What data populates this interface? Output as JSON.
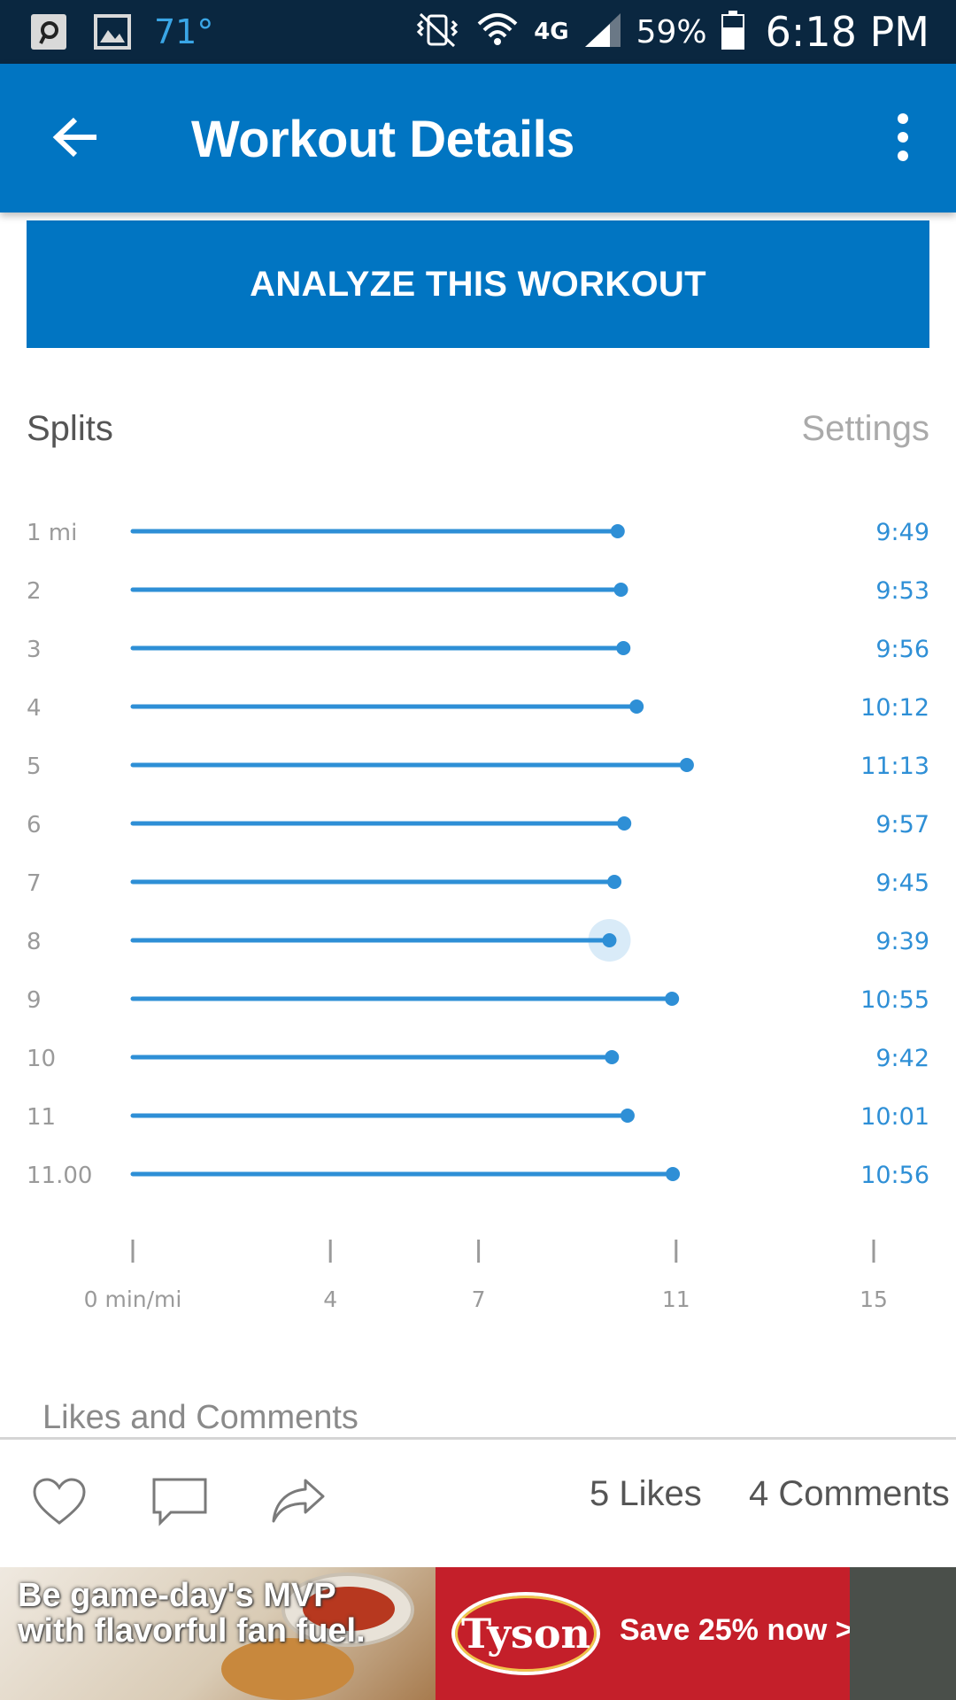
{
  "status_bar": {
    "temperature": "71°",
    "network": "4G",
    "battery": "59%",
    "time": "6:18 PM"
  },
  "app_bar": {
    "title": "Workout Details",
    "back_icon": "arrow-left-icon",
    "menu_icon": "more-vert-icon"
  },
  "analyze_button": "ANALYZE THIS WORKOUT",
  "splits": {
    "title": "Splits",
    "settings_label": "Settings"
  },
  "chart_data": {
    "type": "bar",
    "orientation": "horizontal",
    "categories": [
      "1 mi",
      "2",
      "3",
      "4",
      "5",
      "6",
      "7",
      "8",
      "9",
      "10",
      "11",
      "11.00"
    ],
    "values": [
      9.817,
      9.883,
      9.933,
      10.2,
      11.217,
      9.95,
      9.75,
      9.65,
      10.917,
      9.7,
      10.017,
      10.933
    ],
    "value_labels": [
      "9:49",
      "9:53",
      "9:56",
      "10:12",
      "11:13",
      "9:57",
      "9:45",
      "9:39",
      "10:55",
      "9:42",
      "10:01",
      "10:56"
    ],
    "highlighted_index": 7,
    "x_ticks": [
      0,
      4,
      7,
      11,
      15
    ],
    "x_tick_labels": [
      "0 min/mi",
      "4",
      "7",
      "11",
      "15"
    ],
    "xlim": [
      0,
      15
    ],
    "series_color": "#2e8fd6",
    "title": "",
    "xlabel": "",
    "ylabel": "",
    "grid": false
  },
  "social": {
    "heading": "Likes and Comments",
    "likes": "5 Likes",
    "comments": "4 Comments",
    "icons": [
      "heart-icon",
      "comment-icon",
      "share-icon"
    ]
  },
  "ad": {
    "text": "Be game-day's MVP with flavorful fan fuel.",
    "brand": "Tyson",
    "cta": "Save 25% now >"
  },
  "colors": {
    "status_bar": "#0a2740",
    "primary": "#0175c2",
    "accent": "#2e8fd6",
    "ad_red": "#c41f2a"
  }
}
